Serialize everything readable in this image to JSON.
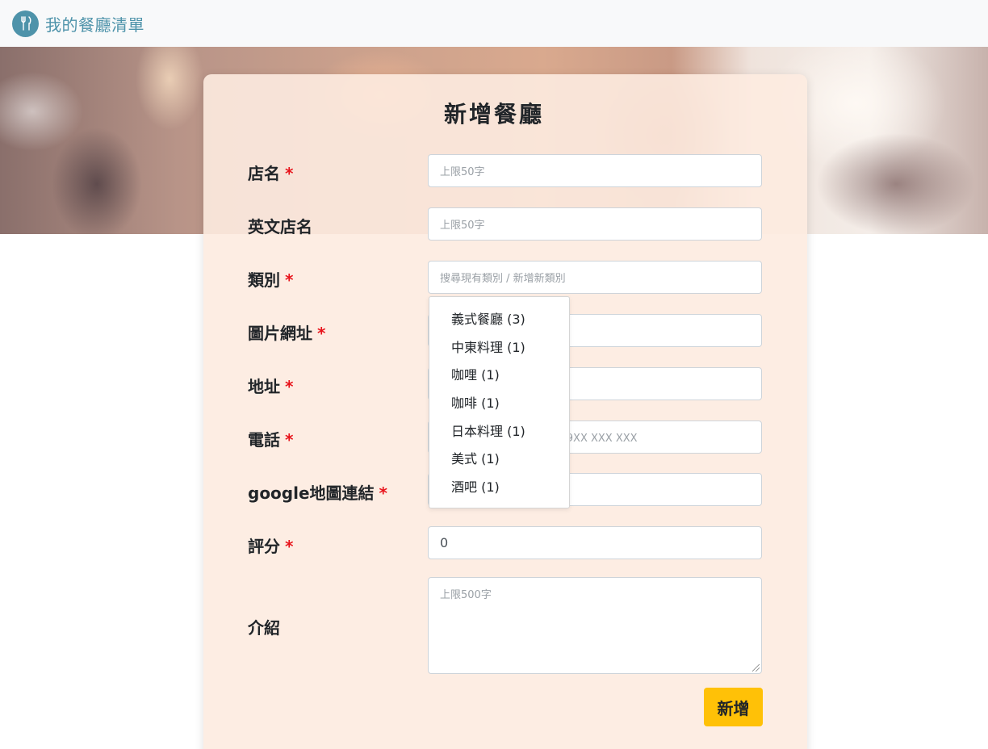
{
  "nav": {
    "brand": "我的餐廳清單",
    "logo_icon": "utensils-icon"
  },
  "form": {
    "title": "新增餐廳",
    "required_mark": "*",
    "fields": [
      {
        "label": "店名",
        "required": true,
        "placeholder": "上限50字",
        "value": ""
      },
      {
        "label": "英文店名",
        "required": false,
        "placeholder": "上限50字",
        "value": ""
      },
      {
        "label": "類別",
        "required": true,
        "placeholder": "搜尋現有類別 / 新增新類別",
        "value": ""
      },
      {
        "label": "圖片網址",
        "required": true,
        "placeholder": "",
        "value": ""
      },
      {
        "label": "地址",
        "required": true,
        "placeholder": "",
        "value": ""
      },
      {
        "label": "電話",
        "required": true,
        "placeholder": "手機: 09XX XXX XXX",
        "value": ""
      },
      {
        "label": "google地圖連結",
        "required": true,
        "placeholder": "",
        "value": ""
      },
      {
        "label": "評分",
        "required": true,
        "placeholder": "",
        "value": "0"
      },
      {
        "label": "介紹",
        "required": false,
        "placeholder": "上限500字",
        "value": ""
      }
    ],
    "submit_label": "新增"
  },
  "category_dropdown": {
    "options": [
      "義式餐廳 (3)",
      "中東料理 (1)",
      "咖哩 (1)",
      "咖啡 (1)",
      "日本料理 (1)",
      "美式 (1)",
      "酒吧 (1)"
    ]
  },
  "colors": {
    "accent": "#4e93aa",
    "card_bg": "#fdebe0",
    "button": "#ffc107",
    "required": "#e8131b"
  }
}
